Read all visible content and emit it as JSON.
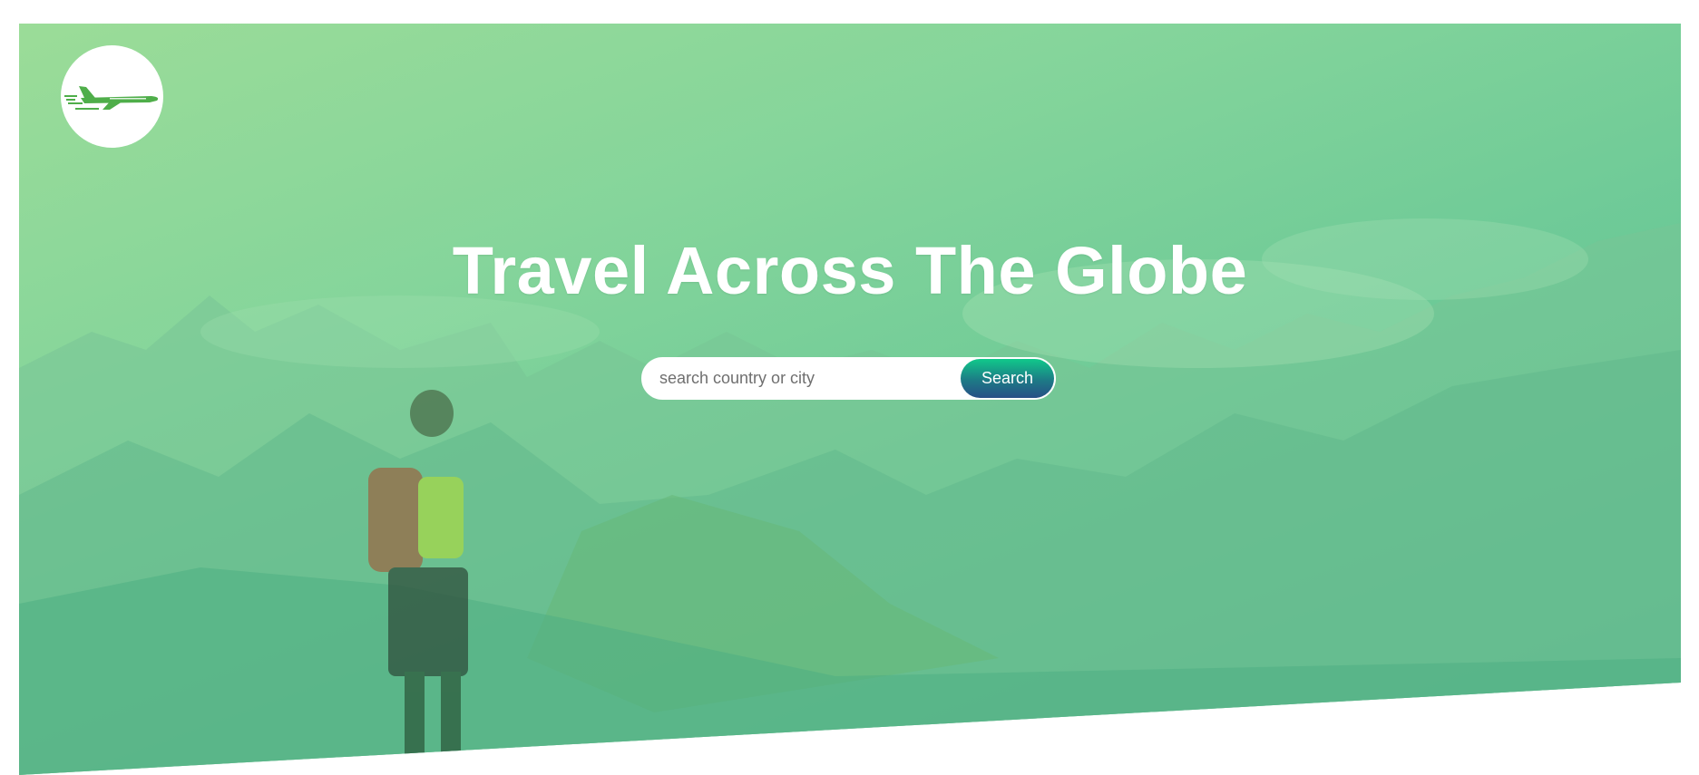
{
  "hero": {
    "title": "Travel Across The Globe"
  },
  "logo": {
    "icon": "airplane-icon"
  },
  "search": {
    "placeholder": "search country or city",
    "value": "",
    "button_label": "Search"
  },
  "colors": {
    "overlay_top": "#9bdc98",
    "overlay_bottom": "#55b892",
    "button_top": "#10c98a",
    "button_bottom": "#274f86",
    "title": "#ffffff"
  }
}
